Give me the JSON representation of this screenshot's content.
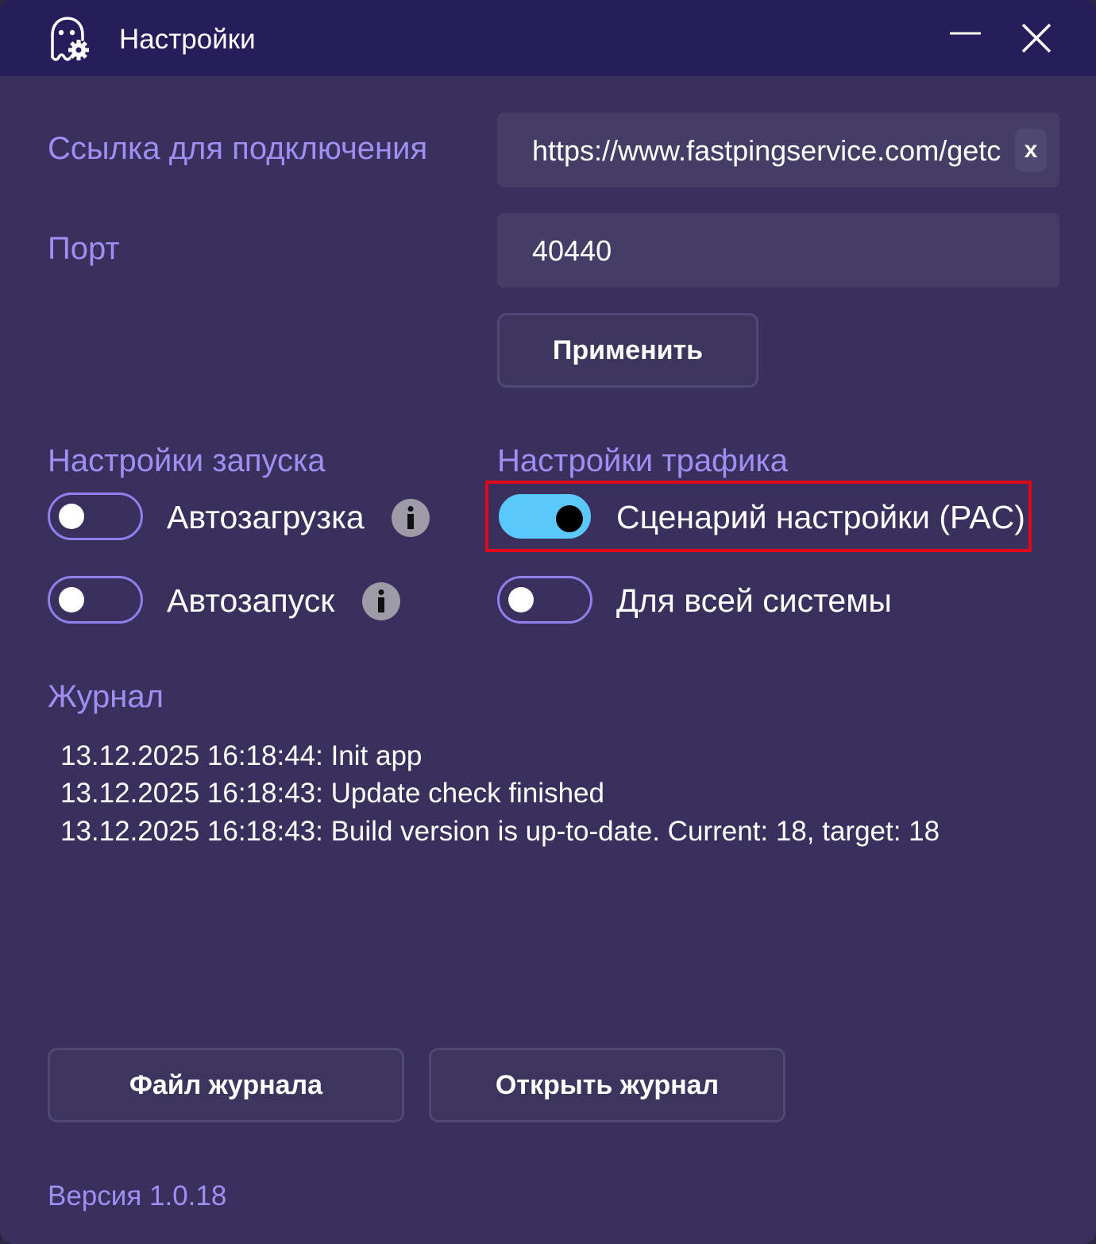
{
  "window": {
    "title": "Настройки",
    "app_icon": "ghost-gear-icon",
    "minimize_icon": "minimize-icon",
    "close_icon": "close-icon"
  },
  "connection": {
    "label": "Ссылка для подключения",
    "url_value": "https://www.fastpingservice.com/getc",
    "clear_label": "x"
  },
  "port": {
    "label": "Порт",
    "value": "40440"
  },
  "apply_button": "Применить",
  "launch_settings": {
    "heading": "Настройки запуска",
    "items": [
      {
        "label": "Автозагрузка",
        "enabled": false,
        "info_icon": "info-icon"
      },
      {
        "label": "Автозапуск",
        "enabled": false,
        "info_icon": "info-icon"
      }
    ]
  },
  "traffic_settings": {
    "heading": "Настройки трафика",
    "items": [
      {
        "label": "Сценарий настройки (PAC)",
        "enabled": true
      },
      {
        "label": "Для всей системы",
        "enabled": false
      }
    ]
  },
  "log": {
    "heading": "Журнал",
    "lines": [
      "13.12.2025 16:18:44: Init app",
      "13.12.2025 16:18:43: Update check finished",
      "13.12.2025 16:18:43: Build version is up-to-date. Current: 18, target: 18"
    ]
  },
  "log_file_button": "Файл журнала",
  "open_log_button": "Открыть журнал",
  "version": "Версия 1.0.18",
  "colors": {
    "background": "#3a2f5d",
    "titlebar": "#261d5b",
    "accent_label": "#9f8ff3",
    "toggle_on": "#5ac8fa",
    "highlight": "#e0061c"
  }
}
